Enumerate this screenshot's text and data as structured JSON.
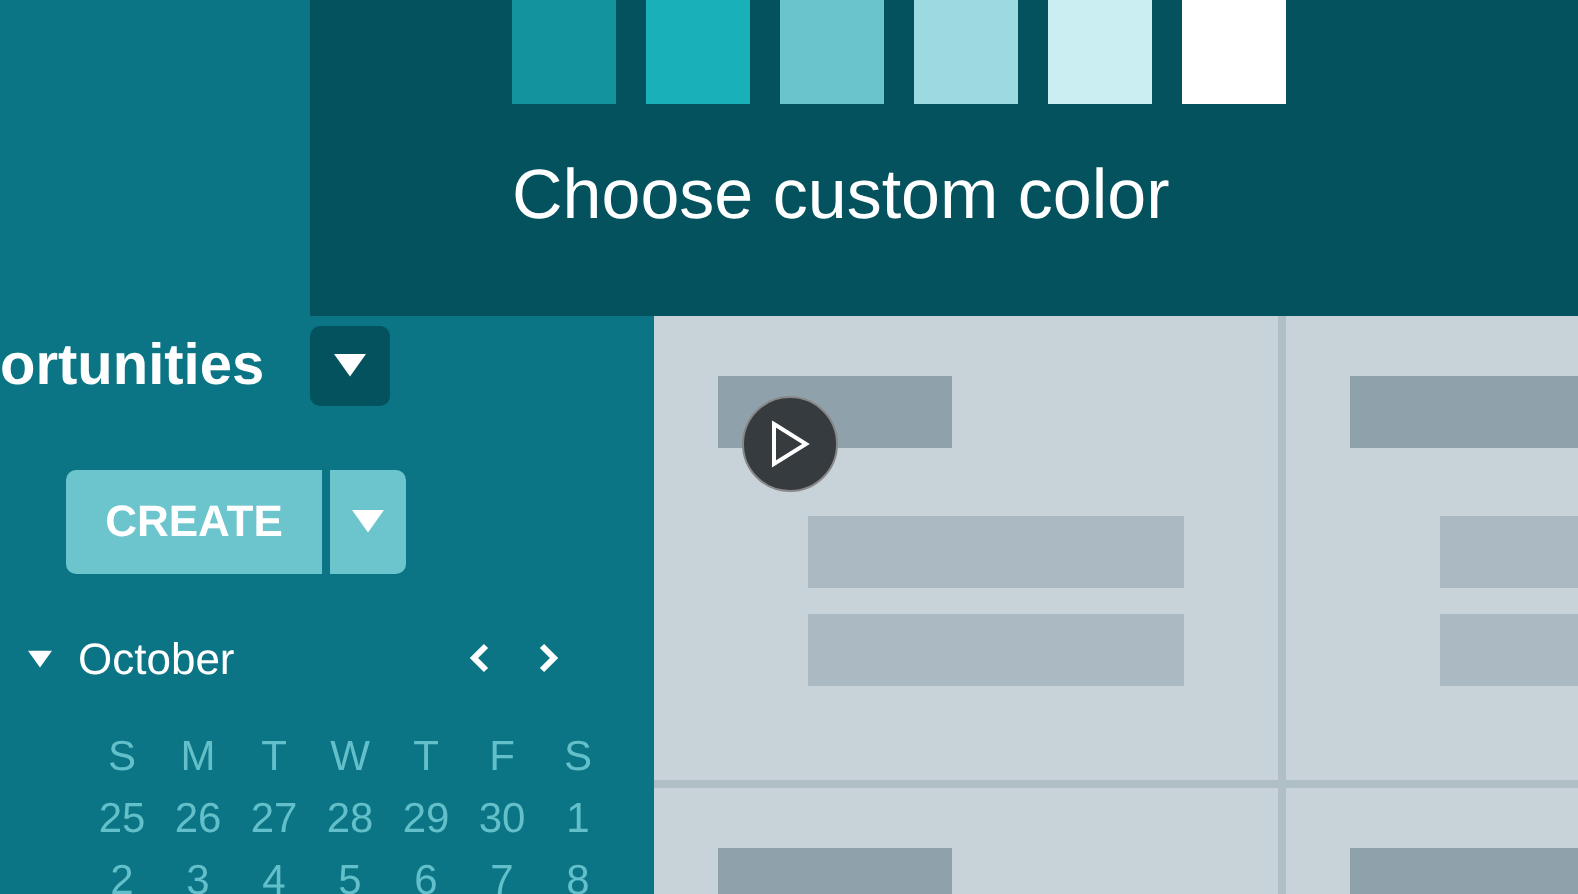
{
  "color_picker": {
    "swatches": [
      {
        "color": "#12939e"
      },
      {
        "color": "#1ab0ba"
      },
      {
        "color": "#69c4cc"
      },
      {
        "color": "#9adae0"
      },
      {
        "color": "#cbeef2"
      },
      {
        "color": "#ffffff"
      }
    ],
    "title": "Choose custom color"
  },
  "sidebar": {
    "heading": "ortunities",
    "create_button": "CREATE",
    "calendar": {
      "month": "October",
      "expanded": true,
      "weekdays": [
        "S",
        "M",
        "T",
        "W",
        "T",
        "F",
        "S"
      ],
      "weeks": [
        [
          "25",
          "26",
          "27",
          "28",
          "29",
          "30",
          "1"
        ],
        [
          "2",
          "3",
          "4",
          "5",
          "6",
          "7",
          "8"
        ]
      ]
    }
  }
}
